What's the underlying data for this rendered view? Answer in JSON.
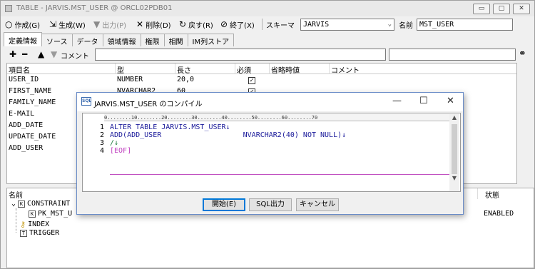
{
  "window": {
    "title": "TABLE - JARVIS.MST_USER @ ORCL02PDB01",
    "buttons": [
      "▭",
      "▢",
      "✕"
    ]
  },
  "toolbar": {
    "create_label": "作成(G)",
    "generate_label": "生成(W)",
    "output_label": "出力(P)",
    "delete_label": "削除(D)",
    "back_label": "戻す(R)",
    "end_label": "終了(X)",
    "schema_label": "スキーマ",
    "schema_value": "JARVIS",
    "name_label": "名前",
    "name_value": "MST_USER"
  },
  "tabs": [
    "定義情報",
    "ソース",
    "データ",
    "領域情報",
    "権限",
    "相関",
    "IM列ストア"
  ],
  "column_toolbar": {
    "comment_label": "コメント"
  },
  "grid": {
    "headers": [
      "項目名",
      "型",
      "長さ",
      "必須",
      "省略時値",
      "コメント"
    ],
    "rows": [
      {
        "name": "USER_ID",
        "type": "NUMBER",
        "length": "20,0",
        "required": true
      },
      {
        "name": "FIRST_NAME",
        "type": "NVARCHAR2",
        "length": "60",
        "required": true
      },
      {
        "name": "FAMILY_NAME",
        "type": "",
        "length": "",
        "required": false
      },
      {
        "name": "E-MAIL",
        "type": "",
        "length": "",
        "required": false
      },
      {
        "name": "ADD_DATE",
        "type": "",
        "length": "",
        "required": false
      },
      {
        "name": "UPDATE_DATE",
        "type": "",
        "length": "",
        "required": false
      },
      {
        "name": "ADD_USER",
        "type": "",
        "length": "",
        "required": false
      }
    ]
  },
  "objects": {
    "name_header": "名前",
    "status_header": "状態",
    "tree": [
      {
        "label": "CONSTRAINT",
        "level": 0
      },
      {
        "label": "PK_MST_U",
        "level": 1
      },
      {
        "label": "INDEX",
        "level": 0
      },
      {
        "label": "TRIGGER",
        "level": 0
      }
    ],
    "status_value": "ENABLED"
  },
  "dialog": {
    "title": "JARVIS.MST_USER のコンパイル",
    "icon_label": "SQL",
    "ruler": "0........10........20........30........40........50........60........70",
    "lines": [
      {
        "no": "1",
        "text": "ALTER TABLE JARVIS.MST_USER↓"
      },
      {
        "no": "2",
        "text": "ADD(ADD_USER                   NVARCHAR2(40) NOT NULL)↓"
      },
      {
        "no": "3",
        "text": "/↓"
      },
      {
        "no": "4",
        "text": "[EOF]"
      }
    ],
    "buttons": {
      "start": "開始(E)",
      "sql_output": "SQL出力",
      "cancel": "キャンセル"
    },
    "controls": {
      "minimize": "—",
      "maximize": "☐",
      "close": "✕"
    }
  }
}
